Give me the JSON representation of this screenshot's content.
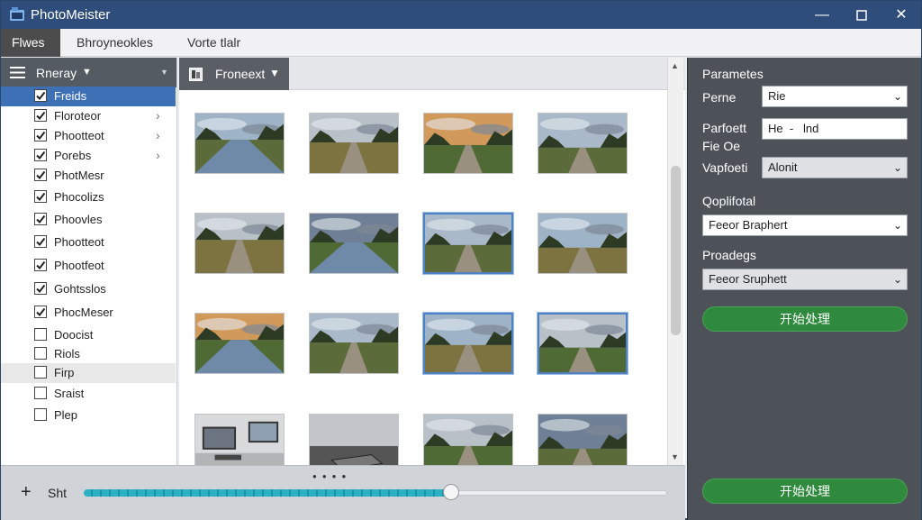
{
  "window": {
    "title": "PhotoMeister",
    "minimize_icon": "minimize-icon",
    "maximize_icon": "maximize-icon",
    "close_icon": "close-icon"
  },
  "menu": {
    "items": [
      "Flwes",
      "Bhroyneokles",
      "Vorte tlalr"
    ]
  },
  "left_panel": {
    "header_label": "Rneray",
    "items": [
      {
        "label": "Freids",
        "checked": true,
        "selected": true,
        "has_children": false
      },
      {
        "label": "Floroteor",
        "checked": true,
        "selected": false,
        "has_children": true
      },
      {
        "label": "Phootteot",
        "checked": true,
        "selected": false,
        "has_children": true
      },
      {
        "label": "Porebs",
        "checked": true,
        "selected": false,
        "has_children": true
      },
      {
        "label": "PhotMesr",
        "checked": true,
        "selected": false,
        "has_children": false
      },
      {
        "label": "Phocolizs",
        "checked": true,
        "selected": false,
        "has_children": false
      },
      {
        "label": "Phoovles",
        "checked": true,
        "selected": false,
        "has_children": false
      },
      {
        "label": "Phootteot",
        "checked": true,
        "selected": false,
        "has_children": false
      },
      {
        "label": "Phootfeot",
        "checked": true,
        "selected": false,
        "has_children": false
      },
      {
        "label": "Gohtsslos",
        "checked": true,
        "selected": false,
        "has_children": false
      },
      {
        "label": "PhocMeser",
        "checked": true,
        "selected": false,
        "has_children": false
      },
      {
        "label": "Doocist",
        "checked": false,
        "selected": false,
        "has_children": false
      },
      {
        "label": "Riols",
        "checked": false,
        "selected": false,
        "has_children": false
      },
      {
        "label": "Firp",
        "checked": false,
        "selected": false,
        "has_children": false,
        "hover": true
      },
      {
        "label": "Sraist",
        "checked": false,
        "selected": false,
        "has_children": false
      },
      {
        "label": "Plep",
        "checked": false,
        "selected": false,
        "has_children": false
      }
    ]
  },
  "center": {
    "tab_label": "Froneext",
    "thumbnails": [
      {
        "scene": "lake-cliffs",
        "selected": false
      },
      {
        "scene": "dirt-path-field",
        "selected": false
      },
      {
        "scene": "sunset-road-trees",
        "selected": false
      },
      {
        "scene": "rail-track-field",
        "selected": false
      },
      {
        "scene": "grass-path-trees",
        "selected": false
      },
      {
        "scene": "forest-canal",
        "selected": false
      },
      {
        "scene": "forest-road",
        "selected": true
      },
      {
        "scene": "field-path",
        "selected": false
      },
      {
        "scene": "sunset-lake",
        "selected": false
      },
      {
        "scene": "green-path",
        "selected": false
      },
      {
        "scene": "pine-road",
        "selected": true
      },
      {
        "scene": "mountain-meadow",
        "selected": true
      },
      {
        "scene": "desk-computers",
        "selected": false
      },
      {
        "scene": "road-tablet",
        "selected": false
      },
      {
        "scene": "cloudy-field",
        "selected": false
      },
      {
        "scene": "tree-road",
        "selected": false
      }
    ]
  },
  "bottom": {
    "add_label": "Sht",
    "slider_value": 0.63
  },
  "right_panel": {
    "section_title": "Parametes",
    "rows": [
      {
        "label": "Perne",
        "value": "Rie"
      },
      {
        "label": "Parfoett",
        "label2": "Fie Oe",
        "value": "He  -   lnd"
      },
      {
        "label": "Vapfoeti",
        "value": "Alonit"
      }
    ],
    "output_title": "Qoplifotal",
    "output_value": "Feeor Braphert",
    "progress_title": "Proadegs",
    "progress_value": "Feeor Sruphett",
    "start_button": "开始处理",
    "start_button_bottom": "开始处理"
  },
  "colors": {
    "titlebar": "#2f4d7b",
    "selection": "#3d70b5",
    "accent_green": "#2f8a3e",
    "slider": "#2bb0c4"
  }
}
